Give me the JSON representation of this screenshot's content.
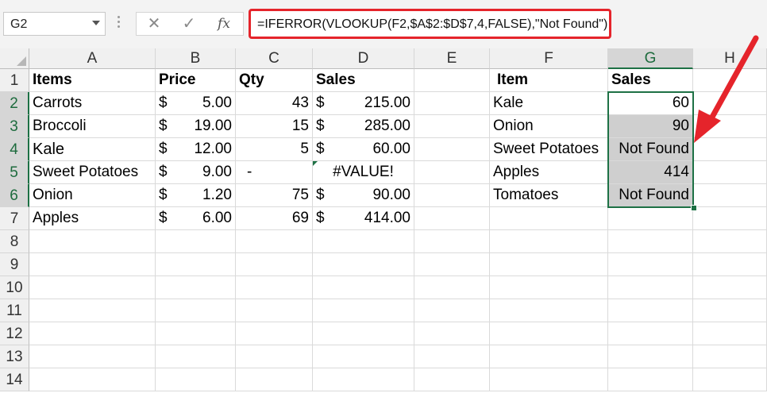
{
  "formula_bar": {
    "name_box": "G2",
    "cancel_glyph": "✕",
    "enter_glyph": "✓",
    "fx_label": "fx",
    "formula": "=IFERROR(VLOOKUP(F2,$A$2:$D$7,4,FALSE),\"Not Found\")"
  },
  "columns": [
    "A",
    "B",
    "C",
    "D",
    "E",
    "F",
    "G",
    "H"
  ],
  "rows": [
    "1",
    "2",
    "3",
    "4",
    "5",
    "6",
    "7",
    "8",
    "9",
    "10",
    "11",
    "12",
    "13",
    "14"
  ],
  "table": {
    "headers": {
      "items": "Items",
      "price": "Price",
      "qty": "Qty",
      "sales": "Sales"
    },
    "currency": "$",
    "rows": [
      {
        "item": "Carrots",
        "price": "5.00",
        "qty": "43",
        "sales": "215.00"
      },
      {
        "item": "Broccoli",
        "price": "19.00",
        "qty": "15",
        "sales": "285.00"
      },
      {
        "item": "Kale",
        "price": "12.00",
        "qty": "5",
        "sales": "60.00"
      },
      {
        "item": "Sweet Potatoes",
        "price": "9.00",
        "qty": "-",
        "sales": "#VALUE!"
      },
      {
        "item": "Onion",
        "price": "1.20",
        "qty": "75",
        "sales": "90.00"
      },
      {
        "item": "Apples",
        "price": "6.00",
        "qty": "69",
        "sales": "414.00"
      }
    ]
  },
  "lookup": {
    "headers": {
      "item": "Item",
      "sales": "Sales"
    },
    "rows": [
      {
        "item": "Kale",
        "sales": "60"
      },
      {
        "item": "Onion",
        "sales": "90"
      },
      {
        "item": "Sweet Potatoes",
        "sales": "Not Found"
      },
      {
        "item": "Apples",
        "sales": "414"
      },
      {
        "item": "Tomatoes",
        "sales": "Not Found"
      }
    ]
  },
  "colors": {
    "highlight": "#e5242b",
    "selection": "#1e7145",
    "selected_fill": "#cfcfcf"
  }
}
